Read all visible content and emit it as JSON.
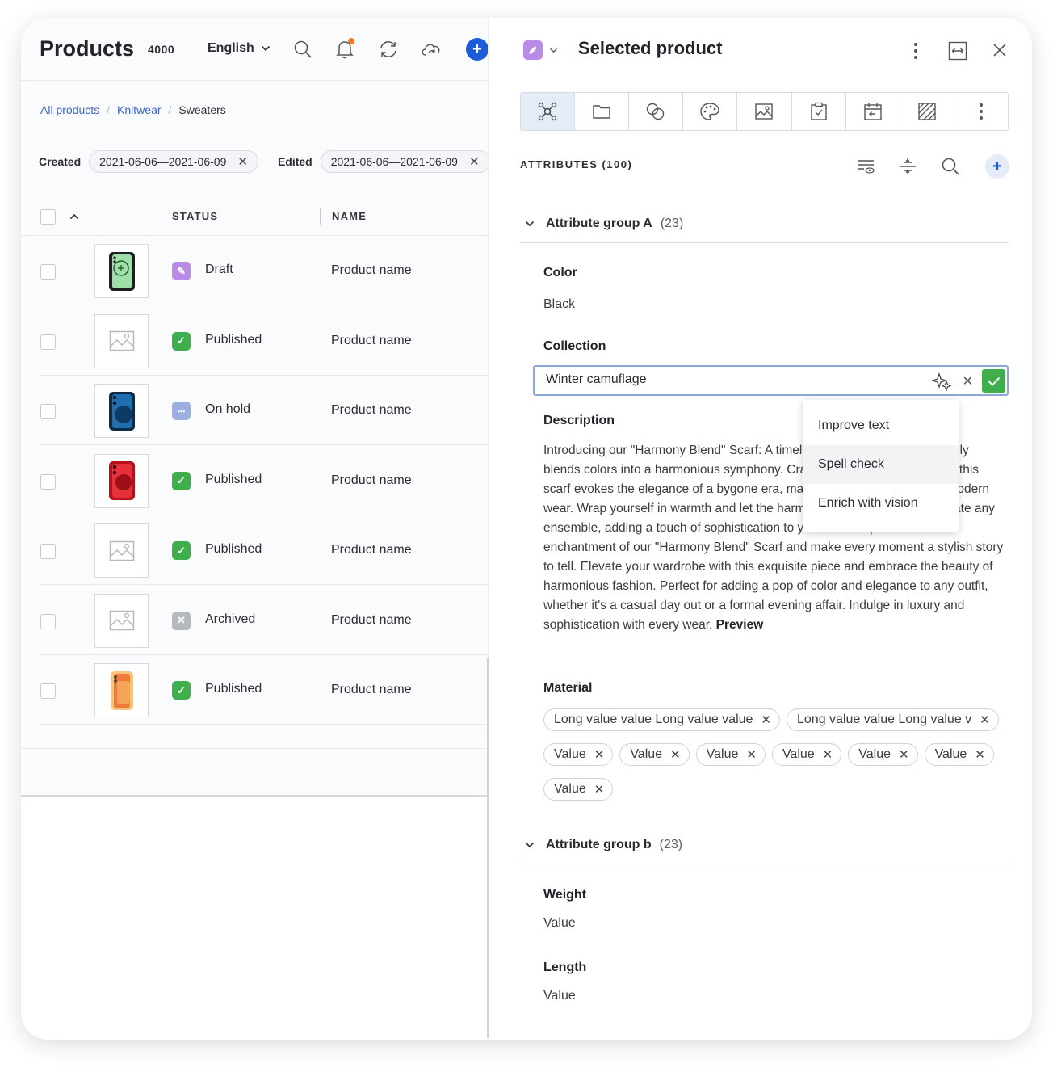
{
  "left": {
    "title": "Products",
    "count": "4000",
    "language": "English",
    "breadcrumbs": [
      "All products",
      "Knitwear",
      "Sweaters"
    ],
    "breadcrumb_sep": "/",
    "filters": [
      {
        "label": "Created",
        "value": "2021-06-06—2021-06-09"
      },
      {
        "label": "Edited",
        "value": "2021-06-06—2021-06-09"
      }
    ],
    "columns": {
      "status": "STATUS",
      "name": "NAME"
    },
    "rows": [
      {
        "status": "Draft",
        "status_color": "#b98ae6",
        "status_icon": "pencil-icon",
        "name": "Product name",
        "thumb": "green-phone"
      },
      {
        "status": "Published",
        "status_color": "#3fae4c",
        "status_icon": "check-icon",
        "name": "Product name",
        "thumb": "placeholder"
      },
      {
        "status": "On hold",
        "status_color": "#9bb0e0",
        "status_icon": "dots-icon",
        "name": "Product name",
        "thumb": "blue-phone"
      },
      {
        "status": "Published",
        "status_color": "#3fae4c",
        "status_icon": "check-icon",
        "name": "Product name",
        "thumb": "red-phone"
      },
      {
        "status": "Published",
        "status_color": "#3fae4c",
        "status_icon": "check-icon",
        "name": "Product name",
        "thumb": "placeholder"
      },
      {
        "status": "Archived",
        "status_color": "#b5b8be",
        "status_icon": "x-icon",
        "name": "Product name",
        "thumb": "placeholder"
      },
      {
        "status": "Published",
        "status_color": "#3fae4c",
        "status_icon": "check-icon",
        "name": "Product name",
        "thumb": "orange-phone"
      }
    ]
  },
  "right": {
    "title": "Selected product",
    "attributes_header": "ATTRIBUTES (100)",
    "group_a": {
      "name": "Attribute group A",
      "count": "(23)"
    },
    "group_b": {
      "name": "Attribute group b",
      "count": "(23)"
    },
    "color": {
      "label": "Color",
      "value": "Black"
    },
    "collection": {
      "label": "Collection",
      "value": "Winter camuflage"
    },
    "description": {
      "label": "Description",
      "text": "Introducing our \"Harmony Blend\" Scarf: A timeless accessory that effortlessly blends colors into a harmonious symphony. Crafted with attention to detail, this scarf evokes the elegance of a bygone era, making it effortlessly chic for modern wear. Wrap yourself in warmth and let the harmonious blend of colors elevate any ensemble, adding a touch of sophistication to your look. Experience the enchantment of our \"Harmony Blend\" Scarf and make every moment a stylish story to tell. Elevate your wardrobe with this exquisite piece and embrace the beauty of harmonious fashion. Perfect for adding a pop of color and elegance to any outfit, whether it's a casual day out or a formal evening affair. Indulge in luxury and sophistication with every wear.",
      "preview": "Preview"
    },
    "ai_menu": [
      "Improve text",
      "Spell check",
      "Enrich with vision"
    ],
    "material": {
      "label": "Material",
      "tags": [
        "Long value value Long value value",
        "Long value value Long value v",
        "Value",
        "Value",
        "Value",
        "Value",
        "Value",
        "Value",
        "Value"
      ]
    },
    "weight": {
      "label": "Weight",
      "value": "Value"
    },
    "length": {
      "label": "Length",
      "value": "Value"
    }
  },
  "colors": {
    "accent": "#1e5bd7",
    "success": "#3fae4c",
    "draft": "#b98ae6",
    "link": "#3b66c9"
  }
}
